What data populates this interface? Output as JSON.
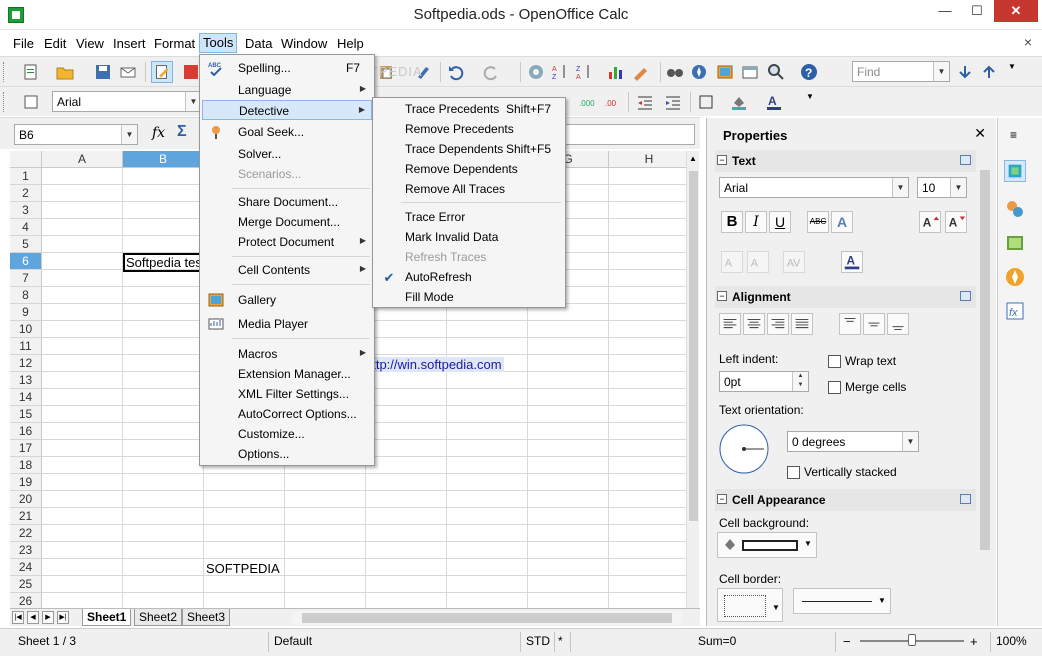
{
  "window": {
    "title": "Softpedia.ods - OpenOffice Calc",
    "minimize": "—",
    "maximize": "☐",
    "close": "✕",
    "doc_close": "×"
  },
  "menubar": [
    "File",
    "Edit",
    "View",
    "Insert",
    "Format",
    "Tools",
    "Data",
    "Window",
    "Help"
  ],
  "toolbar": {
    "font_name": "Arial",
    "find_placeholder": "Find",
    "watermark": "SOFTPEDIA"
  },
  "formula": {
    "name_box": "B6",
    "function_wizard": "fx",
    "sum": "Σ"
  },
  "grid": {
    "columns": [
      "A",
      "B",
      "C",
      "D",
      "E",
      "F",
      "G",
      "H"
    ],
    "selected_column": "B",
    "rows": [
      "1",
      "2",
      "3",
      "4",
      "5",
      "6",
      "7",
      "8",
      "9",
      "10",
      "11",
      "12",
      "13",
      "14",
      "15",
      "16",
      "17",
      "18",
      "19",
      "20",
      "21",
      "22",
      "23",
      "24",
      "25",
      "26"
    ],
    "selected_row": "6",
    "cells": {
      "B6": "Softpedia test",
      "E12": "http://win.softpedia.com",
      "C24": "SOFTPEDIA"
    }
  },
  "sheets": {
    "tabs": [
      "Sheet1",
      "Sheet2",
      "Sheet3"
    ],
    "active": "Sheet1"
  },
  "status": {
    "sheet": "Sheet 1 / 3",
    "page_style": "Default",
    "mode": "STD",
    "modified": "*",
    "sum": "Sum=0",
    "zoom": "100%",
    "zoom_out": "−",
    "zoom_in": "+"
  },
  "tools_menu": {
    "items": [
      {
        "label": "Spelling...",
        "shortcut": "F7",
        "icon": "spelling-icon"
      },
      {
        "label": "Language",
        "submenu": true
      },
      {
        "label": "Detective",
        "submenu": true,
        "highlighted": true
      },
      {
        "label": "Goal Seek...",
        "icon": "goal-seek-icon"
      },
      {
        "label": "Solver..."
      },
      {
        "label": "Scenarios...",
        "disabled": true
      },
      {
        "label": "Share Document..."
      },
      {
        "label": "Merge Document..."
      },
      {
        "label": "Protect Document",
        "submenu": true
      },
      {
        "label": "Cell Contents",
        "submenu": true
      },
      {
        "label": "Gallery",
        "icon": "gallery-icon"
      },
      {
        "label": "Media Player",
        "icon": "media-player-icon"
      },
      {
        "label": "Macros",
        "submenu": true
      },
      {
        "label": "Extension Manager..."
      },
      {
        "label": "XML Filter Settings..."
      },
      {
        "label": "AutoCorrect Options..."
      },
      {
        "label": "Customize..."
      },
      {
        "label": "Options..."
      }
    ]
  },
  "detective_menu": {
    "items": [
      {
        "label": "Trace Precedents",
        "shortcut": "Shift+F7"
      },
      {
        "label": "Remove Precedents"
      },
      {
        "label": "Trace Dependents",
        "shortcut": "Shift+F5"
      },
      {
        "label": "Remove Dependents"
      },
      {
        "label": "Remove All Traces"
      },
      {
        "label": "Trace Error"
      },
      {
        "label": "Mark Invalid Data"
      },
      {
        "label": "Refresh Traces",
        "disabled": true
      },
      {
        "label": "AutoRefresh",
        "checked": true
      },
      {
        "label": "Fill Mode"
      }
    ]
  },
  "sidebar": {
    "title": "Properties",
    "close": "✕",
    "text_section": {
      "title": "Text",
      "font": "Arial",
      "size": "10",
      "bold": "B",
      "italic": "I",
      "underline": "U",
      "strike": "ABC",
      "shadow": "A"
    },
    "alignment_section": {
      "title": "Alignment",
      "left_indent_label": "Left indent:",
      "left_indent_value": "0pt",
      "wrap_text": "Wrap text",
      "merge_cells": "Merge cells",
      "orientation_label": "Text orientation:",
      "degrees": "0 degrees",
      "vertically_stacked": "Vertically stacked"
    },
    "cell_appearance_section": {
      "title": "Cell Appearance",
      "background_label": "Cell background:",
      "border_label": "Cell border:"
    }
  },
  "colors": {
    "selection_header": "#5ea5de",
    "menu_highlight": "#d6e8fa",
    "link": "#1a1aa6",
    "link_bg": "#dfe6f5"
  }
}
